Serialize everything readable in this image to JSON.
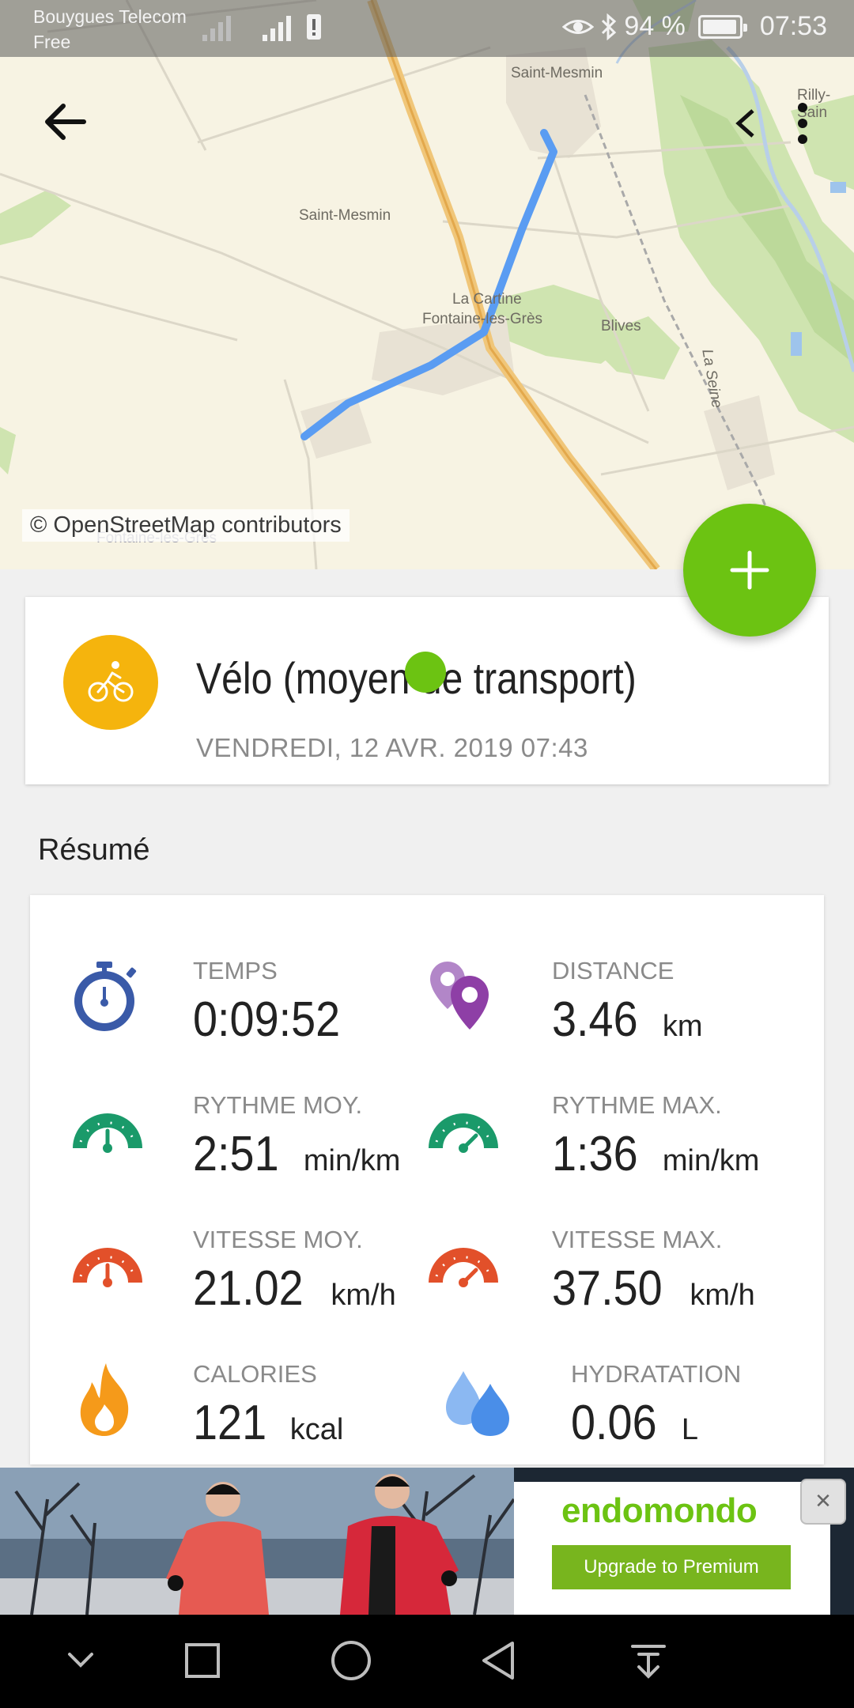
{
  "status_bar": {
    "carrier_primary": "Bouygues Telecom",
    "carrier_secondary": "Free",
    "battery_percent": "94 %",
    "time": "07:53"
  },
  "map": {
    "labels": {
      "saint_mesmin_top": "Saint-Mesmin",
      "rilly": "Rilly-Sain",
      "saint_mesmin_center": "Saint-Mesmin",
      "la_cartine": "La Cartine",
      "fontaine_les_gres": "Fontaine-les-Grès",
      "blives": "Blives",
      "la_seine": "La Seine",
      "fontaine_bottom": "Fontaine-les-Grès"
    },
    "attribution": "© OpenStreetMap contributors",
    "route_color": "#5a9cf2"
  },
  "activity": {
    "title": "Vélo (moyen de transport)",
    "date": "VENDREDI, 12 AVR. 2019 07:43",
    "icon": "bike-icon",
    "icon_color": "#f5b40d"
  },
  "summary": {
    "title": "Résumé",
    "stats": [
      {
        "label": "TEMPS",
        "value": "0:09:52",
        "unit": "",
        "icon": "stopwatch-icon"
      },
      {
        "label": "DISTANCE",
        "value": "3.46",
        "unit": "km",
        "icon": "map-pins-icon"
      },
      {
        "label": "RYTHME MOY.",
        "value": "2:51",
        "unit": "min/km",
        "icon": "gauge-green-avg-icon"
      },
      {
        "label": "RYTHME MAX.",
        "value": "1:36",
        "unit": "min/km",
        "icon": "gauge-green-max-icon"
      },
      {
        "label": "VITESSE MOY.",
        "value": "21.02",
        "unit": "km/h",
        "icon": "gauge-red-avg-icon"
      },
      {
        "label": "VITESSE MAX.",
        "value": "37.50",
        "unit": "km/h",
        "icon": "gauge-red-max-icon"
      },
      {
        "label": "CALORIES",
        "value": "121",
        "unit": "kcal",
        "icon": "flame-icon"
      },
      {
        "label": "HYDRATATION",
        "value": "0.06",
        "unit": "L",
        "icon": "water-drops-icon"
      }
    ]
  },
  "ad": {
    "brand": "endomondo",
    "cta": "Upgrade to Premium"
  },
  "colors": {
    "accent_green": "#6cc312",
    "stopwatch_blue": "#3a5aa8",
    "pin_purple": "#8e3fa6",
    "gauge_green": "#1a9a6a",
    "gauge_red": "#e2502a",
    "flame_orange": "#f59a1a",
    "drop_blue": "#4a8ee8"
  }
}
